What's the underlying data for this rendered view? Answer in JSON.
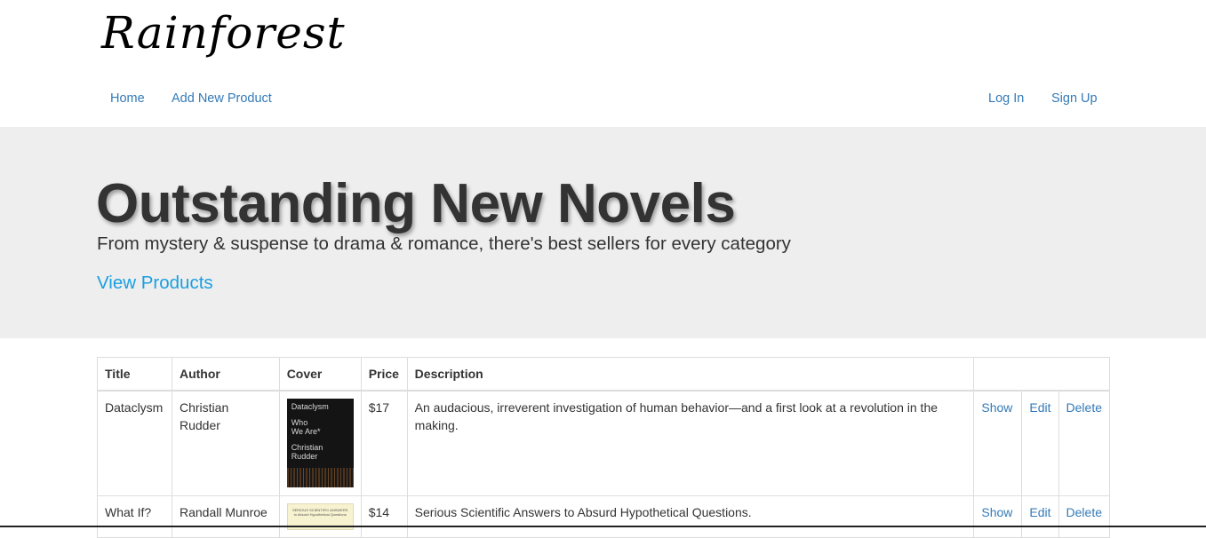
{
  "brand": {
    "logo_text": "Rainforest"
  },
  "nav": {
    "home": "Home",
    "add_product": "Add New Product",
    "log_in": "Log In",
    "sign_up": "Sign Up"
  },
  "hero": {
    "title": "Outstanding New Novels",
    "subtitle": "From mystery & suspense to drama & romance, there's best sellers for every category",
    "cta": "View Products"
  },
  "table": {
    "headers": {
      "title": "Title",
      "author": "Author",
      "cover": "Cover",
      "price": "Price",
      "description": "Description",
      "actions": ""
    },
    "actions": {
      "show": "Show",
      "edit": "Edit",
      "delete": "Delete"
    },
    "rows": [
      {
        "title": "Dataclysm",
        "author": "Christian Rudder",
        "price": "$17",
        "description": "An audacious, irreverent investigation of human behavior—and a first look at a revolution in the making.",
        "cover_text": [
          "Dataclysm",
          "Who",
          "We Are*",
          "Christian",
          "Rudder"
        ]
      },
      {
        "title": "What If?",
        "author": "Randall Munroe",
        "price": "$14",
        "description": "Serious Scientific Answers to Absurd Hypothetical Questions.",
        "cover_text": [
          "SERIOUS SCIENTIFIC ANSWERS",
          "to Absurd Hypothetical Questions"
        ]
      }
    ]
  },
  "colors": {
    "link": "#337ab7",
    "hero_link": "#1a9fe0",
    "hero_bg": "#eeeeee"
  }
}
